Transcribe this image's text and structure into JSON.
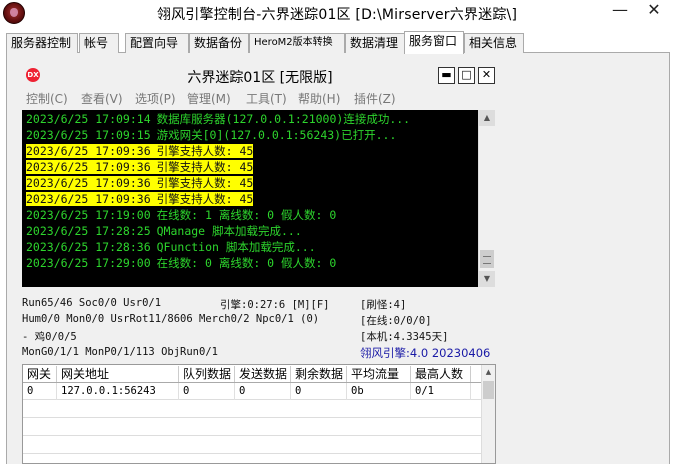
{
  "window": {
    "title": "翎风引擎控制台-六界迷踪01区 [D:\\Mirserver六界迷踪\\]",
    "minimize_glyph": "—",
    "close_glyph": "✕"
  },
  "tabs": [
    {
      "label": "服务器控制"
    },
    {
      "label": "帐号"
    },
    {
      "label": "配置向导"
    },
    {
      "label": "数据备份"
    },
    {
      "label": "HeroM2版本转换"
    },
    {
      "label": "数据清理"
    },
    {
      "label": "服务窗口",
      "active": true
    },
    {
      "label": "相关信息"
    }
  ],
  "server_window": {
    "title": "六界迷踪01区 [无限版]",
    "icon_text": "DX",
    "menu": [
      "控制(C)",
      "查看(V)",
      "选项(P)",
      "管理(M)",
      "工具(T)",
      "帮助(H)",
      "插件(Z)"
    ],
    "buttons": {
      "minimize": "▬",
      "restore": "□",
      "close": "✕"
    }
  },
  "log": [
    {
      "time": "2023/6/25 17:09:14",
      "message": "数据库服务器(127.0.0.1:21000)连接成功...",
      "highlight": false
    },
    {
      "time": "2023/6/25 17:09:15",
      "message": "游戏网关[0](127.0.0.1:56243)已打开...",
      "highlight": false
    },
    {
      "time": "2023/6/25 17:09:36",
      "message": "引擎支持人数: 45",
      "highlight": true
    },
    {
      "time": "2023/6/25 17:09:36",
      "message": "引擎支持人数: 45",
      "highlight": true
    },
    {
      "time": "2023/6/25 17:09:36",
      "message": "引擎支持人数: 45",
      "highlight": true
    },
    {
      "time": "2023/6/25 17:09:36",
      "message": "引擎支持人数: 45",
      "highlight": true
    },
    {
      "time": "2023/6/25 17:19:00",
      "message": "在线数: 1 离线数: 0 假人数: 0",
      "highlight": false
    },
    {
      "time": "2023/6/25 17:28:25",
      "message": "QManage 脚本加载完成...",
      "highlight": false
    },
    {
      "time": "2023/6/25 17:28:36",
      "message": "QFunction 脚本加载完成...",
      "highlight": false
    },
    {
      "time": "2023/6/25 17:29:00",
      "message": "在线数: 0 离线数: 0 假人数: 0",
      "highlight": false
    }
  ],
  "status": {
    "line1_left": "Run65/46 Soc0/0 Usr0/1",
    "line1_mid": "引擎:0:27:6 [M][F]",
    "line1_right": "[刷怪:4]",
    "line2_left": "Hum0/0 Mon0/0 UsrRot11/8606 Merch0/2 Npc0/1 (0)",
    "line2_right": "[在线:0/0/0]",
    "line3_left": "- 鸡0/0/5",
    "line3_right": "[本机:4.3345天]",
    "line4_left": "MonG0/1/1 MonP0/1/113 ObjRun0/1",
    "line4_right": "翎风引擎:4.0 20230406"
  },
  "gateway_table": {
    "columns": [
      "网关",
      "网关地址",
      "队列数据",
      "发送数据",
      "剩余数据",
      "平均流量",
      "最高人数"
    ],
    "rows": [
      [
        "0",
        "127.0.0.1:56243",
        "0",
        "0",
        "0",
        "0b",
        "0/1"
      ]
    ]
  }
}
